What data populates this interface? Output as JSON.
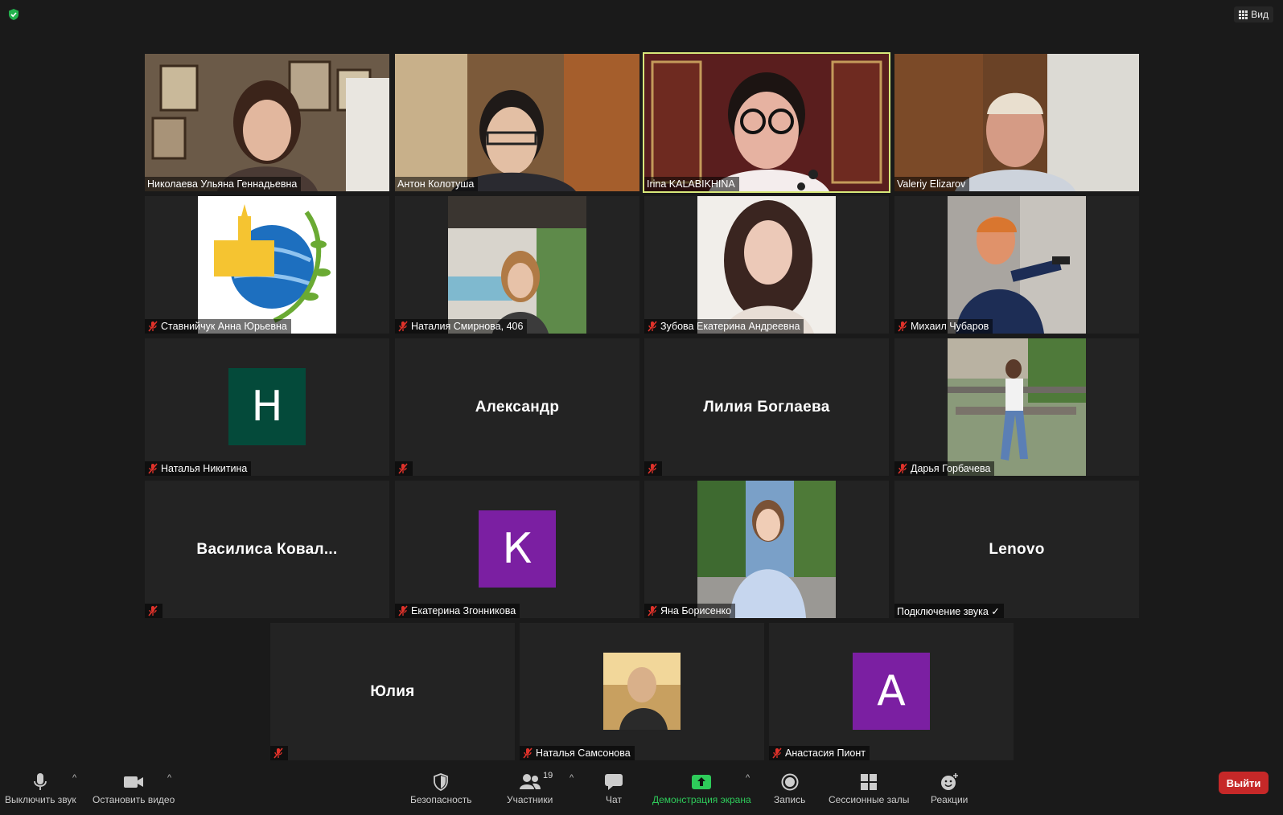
{
  "topbar": {
    "view_label": "Вид"
  },
  "tiles": [
    {
      "name": "Николаева Ульяна Геннадьевна",
      "muted": false
    },
    {
      "name": "Антон Колотуша",
      "muted": false
    },
    {
      "name": "Irina KALABIKHINA",
      "muted": false,
      "active": true
    },
    {
      "name": "Valeriy Elizarov",
      "muted": false
    },
    {
      "name": "Ставнийчук Анна Юрьевна",
      "muted": true
    },
    {
      "name": "Наталия Смирнова, 406",
      "muted": true
    },
    {
      "name": "Зубова Екатерина Андреевна",
      "muted": true
    },
    {
      "name": "Михаил Чубаров",
      "muted": true
    },
    {
      "name": "Наталья Никитина",
      "muted": true,
      "avatar_letter": "Н",
      "avatar_color": "#044a3a"
    },
    {
      "display_name": "Александр",
      "muted": true
    },
    {
      "display_name": "Лилия Боглаева",
      "muted": true
    },
    {
      "name": "Дарья Горбачева",
      "muted": true
    },
    {
      "display_name": "Василиса  Ковал...",
      "muted": true
    },
    {
      "name": "Екатерина Згонникова",
      "muted": true,
      "avatar_letter": "К",
      "avatar_color": "#7b1fa2"
    },
    {
      "name": "Яна Борисенко",
      "muted": true
    },
    {
      "display_name": "Lenovo",
      "name": "Подключение звука ✓",
      "muted": false
    },
    {
      "display_name": "Юлия",
      "muted": true
    },
    {
      "name": "Наталья Самсонова",
      "muted": true
    },
    {
      "name": "Анастасия Пионт",
      "muted": true,
      "avatar_letter": "А",
      "avatar_color": "#7b1fa2"
    }
  ],
  "toolbar": {
    "mute_label": "Выключить звук",
    "video_label": "Остановить видео",
    "security_label": "Безопасность",
    "participants_label": "Участники",
    "participants_count": "19",
    "chat_label": "Чат",
    "share_label": "Демонстрация экрана",
    "record_label": "Запись",
    "breakout_label": "Сессионные залы",
    "reactions_label": "Реакции",
    "leave_label": "Выйти"
  },
  "colors": {
    "active_speaker_border": "#d7e87a",
    "share_green": "#2ecb5a",
    "leave_red": "#c62828"
  }
}
